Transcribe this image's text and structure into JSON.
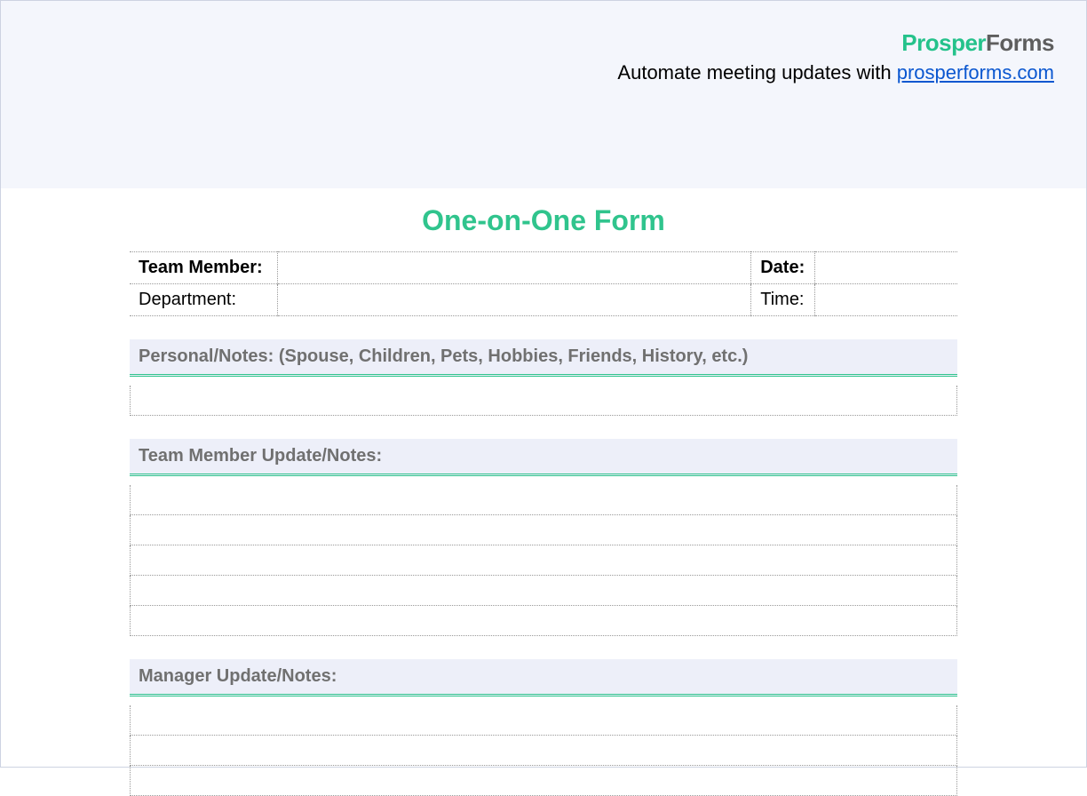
{
  "header": {
    "logo_part1": "Prosper",
    "logo_part2": "Forms",
    "tagline_prefix": "Automate meeting updates with ",
    "tagline_link_text": "prosperforms.com"
  },
  "form": {
    "title": "One-on-One Form",
    "meta": {
      "team_member_label": "Team Member:",
      "team_member_value": "",
      "department_label": "Department:",
      "department_value": "",
      "date_label": "Date:",
      "date_value": "",
      "time_label": "Time:",
      "time_value": ""
    },
    "sections": [
      {
        "title": "Personal/Notes: (Spouse, Children, Pets, Hobbies, Friends, History, etc.)",
        "line_count": 1
      },
      {
        "title": "Team Member Update/Notes:",
        "line_count": 5
      },
      {
        "title": "Manager Update/Notes:",
        "line_count": 3
      }
    ]
  }
}
